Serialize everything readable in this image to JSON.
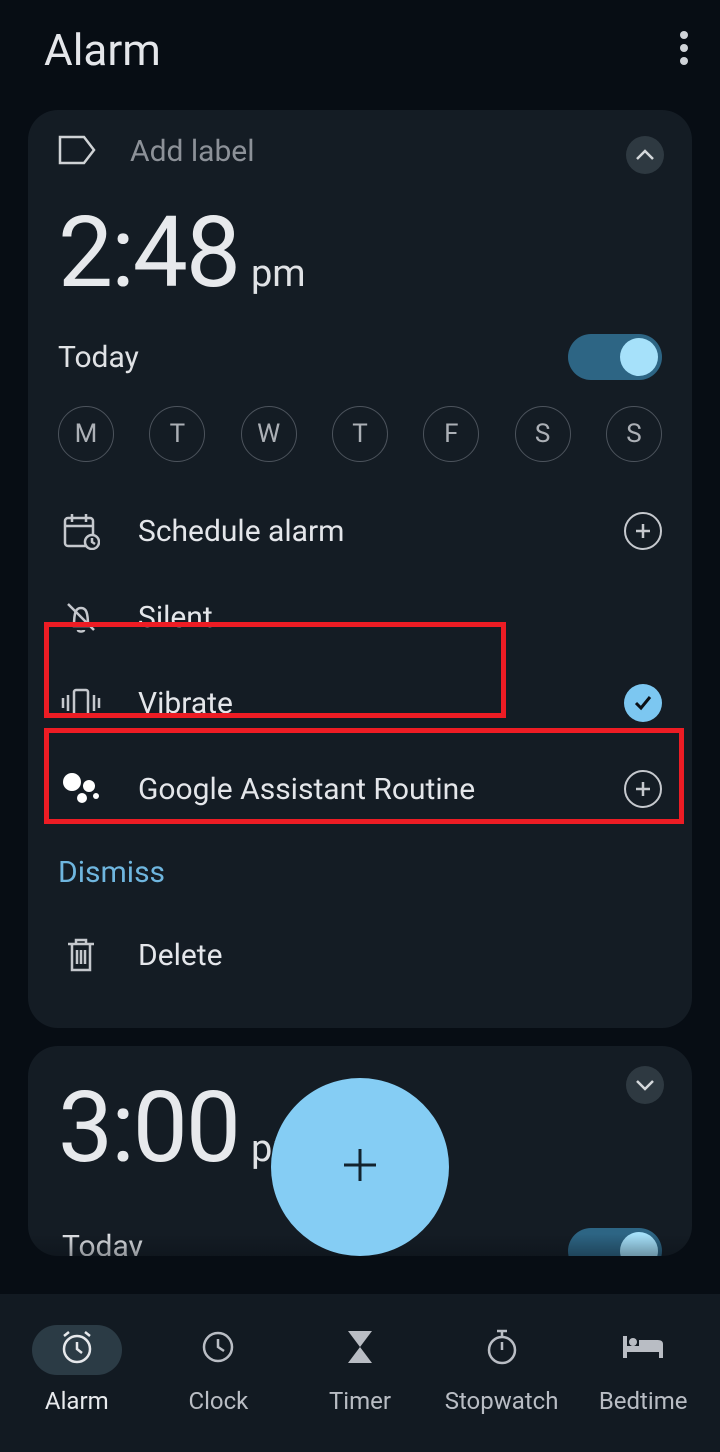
{
  "header": {
    "title": "Alarm"
  },
  "alarm1": {
    "labelPlaceholder": "Add label",
    "time": "2:48",
    "ampm": "pm",
    "dayText": "Today",
    "days": [
      "M",
      "T",
      "W",
      "T",
      "F",
      "S",
      "S"
    ],
    "options": {
      "schedule": "Schedule alarm",
      "sound": "Silent",
      "vibrate": "Vibrate",
      "assistant": "Google Assistant Routine",
      "dismiss": "Dismiss",
      "delete": "Delete"
    }
  },
  "alarm2": {
    "time": "3:00",
    "ampm": "pm",
    "dayText": "Today"
  },
  "nav": {
    "alarm": "Alarm",
    "clock": "Clock",
    "timer": "Timer",
    "stopwatch": "Stopwatch",
    "bedtime": "Bedtime"
  }
}
